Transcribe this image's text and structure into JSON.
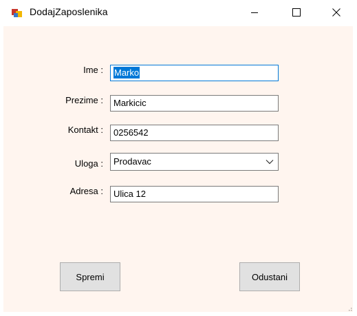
{
  "window": {
    "title": "DodajZaposlenika",
    "controls": {
      "minimize": "minimize-icon",
      "maximize": "maximize-icon",
      "close": "close-icon"
    }
  },
  "form": {
    "fields": [
      {
        "label": "Ime :",
        "value": "Marko",
        "type": "textbox"
      },
      {
        "label": "Prezime :",
        "value": "Markicic",
        "type": "textbox"
      },
      {
        "label": "Kontakt :",
        "value": "0256542",
        "type": "textbox"
      },
      {
        "label": "Uloga :",
        "value": "Prodavac",
        "type": "combobox"
      },
      {
        "label": "Adresa :",
        "value": "Ulica 12",
        "type": "textbox"
      }
    ]
  },
  "buttons": {
    "save_label": "Spremi",
    "cancel_label": "Odustani"
  },
  "colors": {
    "client_background": "#fff5ef",
    "focus_border": "#0078d7",
    "selection": "#0078d7",
    "button_face": "#e1e1e1"
  }
}
